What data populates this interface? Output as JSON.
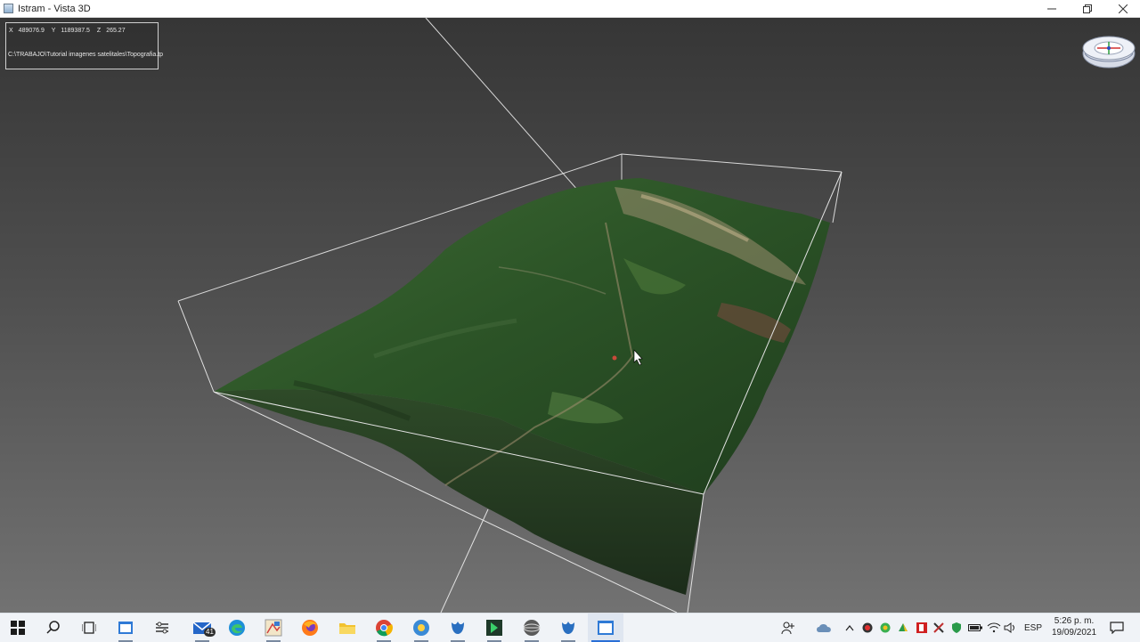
{
  "window": {
    "title": "Istram - Vista 3D",
    "controls": {
      "minimize_icon": "minimize-icon",
      "restore_icon": "restore-icon",
      "close_icon": "close-icon"
    }
  },
  "viewport": {
    "info": {
      "x_label": "X",
      "x_value": "489076.9",
      "y_label": "Y",
      "y_value": "1189387.5",
      "z_label": "Z",
      "z_value": "265.27",
      "file_path": "C:\\TRABAJO\\Tutorial imagenes satelitales\\Topografia.tp"
    },
    "navigation_cube_icon": "navigation-cube-icon",
    "terrain": "satellite-textured-terrain-mesh"
  },
  "taskbar": {
    "items": [
      {
        "name": "start",
        "icon": "windows-start-icon"
      },
      {
        "name": "search",
        "icon": "search-icon"
      },
      {
        "name": "task-view",
        "icon": "task-view-icon"
      },
      {
        "name": "app-a",
        "icon": "app-window-icon"
      },
      {
        "name": "app-b",
        "icon": "settings-tool-icon"
      },
      {
        "name": "mail",
        "icon": "mail-icon",
        "badge": "41"
      },
      {
        "name": "edge",
        "icon": "edge-browser-icon"
      },
      {
        "name": "app-c",
        "icon": "drawing-app-icon"
      },
      {
        "name": "firefox",
        "icon": "firefox-icon"
      },
      {
        "name": "explorer",
        "icon": "folder-icon"
      },
      {
        "name": "chrome",
        "icon": "chrome-icon"
      },
      {
        "name": "app-d",
        "icon": "sun-app-icon"
      },
      {
        "name": "app-e",
        "icon": "tulip-app-icon"
      },
      {
        "name": "app-f",
        "icon": "green-arrow-app-icon"
      },
      {
        "name": "app-g",
        "icon": "globe-app-icon"
      },
      {
        "name": "app-h",
        "icon": "tulip-app-icon"
      },
      {
        "name": "istram",
        "icon": "istram-window-icon",
        "active": true
      }
    ],
    "tray": {
      "language": "ESP",
      "time": "5:26 p. m.",
      "date": "19/09/2021"
    }
  },
  "colors": {
    "accent": "#2a6fd6",
    "viewport_top": "#363636",
    "viewport_bottom": "#727272",
    "terrain_green": "#2f5a2c"
  }
}
